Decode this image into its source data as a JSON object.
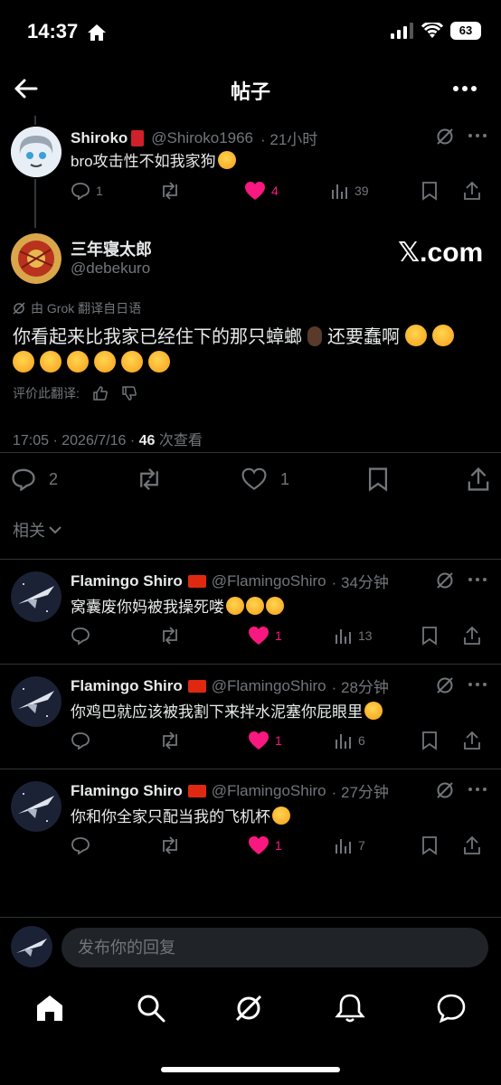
{
  "status": {
    "time": "14:37",
    "battery": "63"
  },
  "header": {
    "title": "帖子"
  },
  "parent_post": {
    "name": "Shiroko",
    "handle": "@Shiroko1966",
    "time": "· 21小时",
    "text": "bro攻击性不如我家狗",
    "replies": "1",
    "likes": "4",
    "views": "39"
  },
  "main_post": {
    "name": "三年寝太郎",
    "handle": "@debekuro",
    "watermark": "𝕏.com",
    "translation_note": "由 Grok 翻译自日语",
    "text_line1": "你看起来比我家已经住下的那只蟑螂",
    "text_line1b": "还要蠢啊",
    "rate_label": "评价此翻译:",
    "timestamp": "17:05 · 2026/7/16 · ",
    "views_count": "46",
    "views_label": " 次查看",
    "replies": "2",
    "likes": "1"
  },
  "related": {
    "label": "相关"
  },
  "replies": [
    {
      "name": "Flamingo Shiro",
      "handle": "@FlamingoShiro",
      "time": "· 34分钟",
      "text": "窝囊废你妈被我操死喽",
      "emoji_count": 3,
      "replies": "",
      "likes": "1",
      "views": "13"
    },
    {
      "name": "Flamingo Shiro",
      "handle": "@FlamingoShiro",
      "time": "· 28分钟",
      "text": "你鸡巴就应该被我割下来拌水泥塞你屁眼里",
      "emoji_count": 1,
      "replies": "",
      "likes": "1",
      "views": "6"
    },
    {
      "name": "Flamingo Shiro",
      "handle": "@FlamingoShiro",
      "time": "· 27分钟",
      "text": "你和你全家只配当我的飞机杯",
      "emoji_count": 1,
      "replies": "",
      "likes": "1",
      "views": "7"
    }
  ],
  "compose": {
    "placeholder": "发布你的回复"
  },
  "tabbar": {
    "items": [
      "home",
      "search",
      "grok",
      "notifications",
      "messages"
    ]
  },
  "colors": {
    "background": "#000000",
    "text": "#e7e9ea",
    "muted": "#71767b",
    "like": "#f91880",
    "divider": "#2f3336"
  }
}
